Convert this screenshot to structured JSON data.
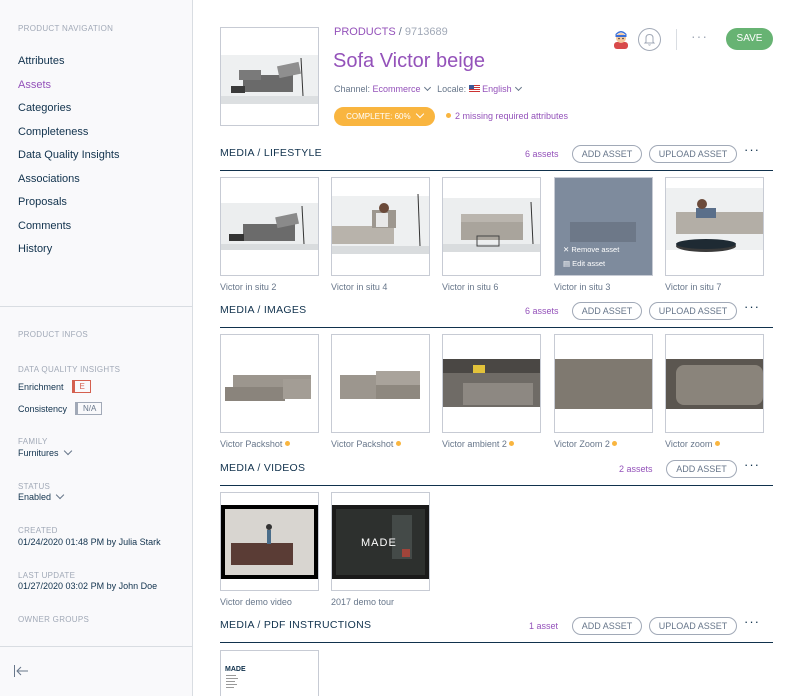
{
  "sidebar": {
    "nav_caption": "PRODUCT NAVIGATION",
    "nav_items": [
      {
        "label": "Attributes"
      },
      {
        "label": "Assets",
        "active": true
      },
      {
        "label": "Categories"
      },
      {
        "label": "Completeness"
      },
      {
        "label": "Data Quality Insights"
      },
      {
        "label": "Associations"
      },
      {
        "label": "Proposals"
      },
      {
        "label": "Comments"
      },
      {
        "label": "History"
      }
    ],
    "infos_caption": "PRODUCT INFOS",
    "dqi_caption": "DATA QUALITY INSIGHTS",
    "enrichment_label": "Enrichment",
    "enrichment_grade": "E",
    "consistency_label": "Consistency",
    "consistency_grade": "N/A",
    "family_caption": "FAMILY",
    "family_value": "Furnitures",
    "status_caption": "STATUS",
    "status_value": "Enabled",
    "created_caption": "CREATED",
    "created_value": "01/24/2020 01:48 PM by Julia Stark",
    "last_update_caption": "LAST UPDATE",
    "last_update_value": "01/27/2020 03:02 PM by John Doe",
    "owner_groups_caption": "OWNER GROUPS"
  },
  "header": {
    "breadcrumb_root": "PRODUCTS",
    "breadcrumb_sep": " / ",
    "sku": "9713689",
    "title": "Sofa Victor beige",
    "channel_label": "Channel:",
    "channel_value": "Ecommerce",
    "locale_label": "Locale:",
    "locale_value": "English",
    "complete_label": "COMPLETE: 60%",
    "missing_label": "2 missing required attributes",
    "more_label": "···",
    "save_label": "SAVE"
  },
  "sections": {
    "lifestyle": {
      "title": "MEDIA / LIFESTYLE",
      "count": "6 assets",
      "add_label": "ADD ASSET",
      "upload_label": "UPLOAD ASSET",
      "more": "···",
      "assets": [
        {
          "caption": "Victor in situ 2"
        },
        {
          "caption": "Victor in situ 4"
        },
        {
          "caption": "Victor in situ 6"
        },
        {
          "caption": "Victor in situ 3",
          "hover_remove": "Remove asset",
          "hover_edit": "Edit asset"
        },
        {
          "caption": "Victor in situ 7"
        }
      ]
    },
    "images": {
      "title": "MEDIA / IMAGES",
      "count": "6 assets",
      "add_label": "ADD ASSET",
      "upload_label": "UPLOAD ASSET",
      "more": "···",
      "assets": [
        {
          "caption": "Victor Packshot"
        },
        {
          "caption": "Victor Packshot"
        },
        {
          "caption": "Victor ambient 2"
        },
        {
          "caption": "Victor Zoom 2"
        },
        {
          "caption": "Victor zoom"
        }
      ]
    },
    "videos": {
      "title": "MEDIA / VIDEOS",
      "count": "2 assets",
      "add_label": "ADD ASSET",
      "more": "···",
      "assets": [
        {
          "caption": "Victor demo video"
        },
        {
          "caption": "2017 demo tour",
          "brand": "MADE"
        }
      ]
    },
    "pdf": {
      "title": "MEDIA / PDF INSTRUCTIONS",
      "count": "1 asset",
      "add_label": "ADD ASSET",
      "upload_label": "UPLOAD ASSET",
      "more": "···",
      "assets": [
        {
          "brand": "MADE"
        }
      ]
    }
  },
  "colors": {
    "accent": "#9452ba",
    "save": "#67b373",
    "warning": "#f9b53f",
    "text": "#11324d",
    "muted": "#67768a"
  }
}
